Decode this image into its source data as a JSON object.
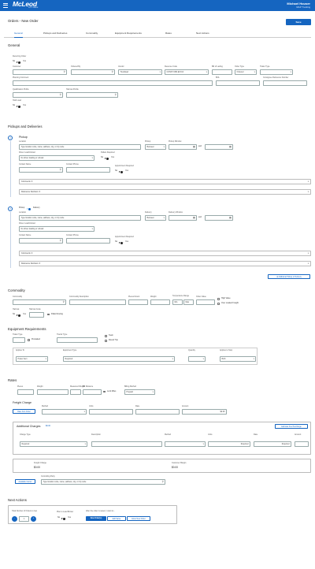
{
  "app": {
    "logo": "McLeod",
    "logo_sub": "SOFTWARE",
    "user_name": "Michael Houser",
    "user_org": "MGP Trucking"
  },
  "page": {
    "title": "Orders - New Order",
    "save_label": "Save"
  },
  "tabs": [
    "General",
    "Pickups and Deliveries",
    "Commodity",
    "Equipment Requirements",
    "Rates",
    "Next Actions"
  ],
  "general": {
    "heading": "General",
    "recurring_order": "Recurring Order",
    "no": "No",
    "yes": "Yes",
    "customer": "Customer",
    "ordered_by": "Ordered By",
    "vendor": "Vendor",
    "vendor_value": "Truckload",
    "revenue_code": "Revenue Code",
    "revenue_value": "CONST 0RS EFO-N",
    "bill_of_lading": "Bill of Lading",
    "bill_value": "",
    "order_type": "Order Type",
    "order_type_value": "Ordered",
    "trailer_type": "Trailer Type",
    "planning_comment": "Planning Comment",
    "bol": "BOL",
    "consignee_ref": "Consignee Reference Number",
    "qualification_profile": "Qualification Profile",
    "hazmat_profile": "Hazmat Profile",
    "hold_load": "Hold Load"
  },
  "pd": {
    "heading": "Pickups and Deliveries",
    "stop1": {
      "num": "1",
      "title": "Pickup",
      "location": "Location",
      "location_placeholder": "Type location code, name, address, city, or zip code",
      "pickup": "Pickup",
      "pickup_value": "Between",
      "window": "Pickup Window",
      "and": "and",
      "driver_load_unload": "Driver Load/Unload",
      "dlu_value": "No driver loading or unload",
      "pallets_required": "Pallets Required",
      "contact_name": "Contact Name",
      "contact_phone": "Contact Phone",
      "appt_required": "Appointment Required",
      "comments": "Comments: 0",
      "ref_numbers": "Reference Numbers: 0"
    },
    "stop2": {
      "num": "2",
      "pickup": "Pickup",
      "delivery": "Delivery",
      "location": "Location",
      "location_placeholder": "Type location code, name, address, city, or zip code",
      "delivery_lbl": "Delivery",
      "delivery_value": "Between",
      "window": "Delivery Window",
      "and": "and",
      "driver_load_unload": "Driver Load/Unload",
      "dlu_value": "No driver loading or unload",
      "contact_name": "Contact Name",
      "contact_phone": "Contact Phone",
      "appt_required": "Appointment Required",
      "comments": "Comments: 0",
      "ref_numbers": "Reference Numbers: 0"
    },
    "add_stop": "Additional Pickup or Delivery",
    "time_placeholder": "24h",
    "time_placeholder2": "Now"
  },
  "commodity": {
    "heading": "Commodity",
    "commodity": "Commodity",
    "description": "Commodity Description",
    "pieces": "Pieces/Count",
    "weight": "Weight",
    "temp_range": "Temperature Range",
    "order_value": "Order Value",
    "min": "Min",
    "max": "Max",
    "high_value": "High Value",
    "over_length": "Over Loaded Freight",
    "hazmat": "Hazmat",
    "hazmat_code": "Hazmat Code",
    "no": "No",
    "yes": "Yes",
    "pallet_routing": "Pallet Routing"
  },
  "equipment": {
    "heading": "Equipment Requirements",
    "trailer_type": "Trailer Type",
    "tractor_type": "Tractor Type",
    "prefloaded": "Preloaded",
    "team": "Team",
    "round_trip": "Round Trip",
    "applies_to": "Applies To",
    "equipment_type": "Equipment Type",
    "quantity": "Quantity",
    "applies_to_stop": "Applies to Stop",
    "row_applies": "Power Item",
    "row_type": "Required",
    "row_stop": "Both"
  },
  "rates": {
    "heading": "Rates",
    "pieces": "Pieces",
    "weight": "Weight",
    "measured_weight": "Measured Weight",
    "bill_distance": "Bill Distance",
    "lock_miles": "Lock Miles",
    "billing_method": "Billing Method",
    "billing_value": "Prepaid",
    "freight_charge": "Freight Charge",
    "rate_from_order": "Rate from Order",
    "method": "Method",
    "units": "Units",
    "rate": "Rate",
    "amount": "Amount",
    "amount_value": "$0.00",
    "additional_charges": "Additional Charges",
    "additional_total": "$0.00",
    "estimate_fuel": "Estimate Fuel Surcharge",
    "charge_type": "Charge Type",
    "description": "Description",
    "method_col": "Method",
    "units_col": "Units",
    "rate_col": "Rate",
    "amount_col": "Amount",
    "charge_value": "Required",
    "units_value": "Required",
    "rate_value": "Required",
    "freight_charge_lbl": "Freight Charge",
    "freight_charge_val": "$0.00",
    "customer_margin": "Customer Margin",
    "customer_margin_val": "$0.00",
    "override_carrier": "Available Carrier",
    "controlling_party": "Controlling Party",
    "controlling_placeholder": "Type location code, name, address, city, or zip code"
  },
  "next": {
    "heading": "Next Actions",
    "num_orders": "Total Number of Orders to Get",
    "qty": "1",
    "plan_load": "Plan to Load Broker",
    "after_saved": "After the order is saved, I want to...",
    "new_order": "New Order(s)",
    "edit_same": "Edit Same",
    "enter_new": "Enter New Order",
    "no": "No",
    "yes": "Yes",
    "minus": "-",
    "plus": "+"
  }
}
